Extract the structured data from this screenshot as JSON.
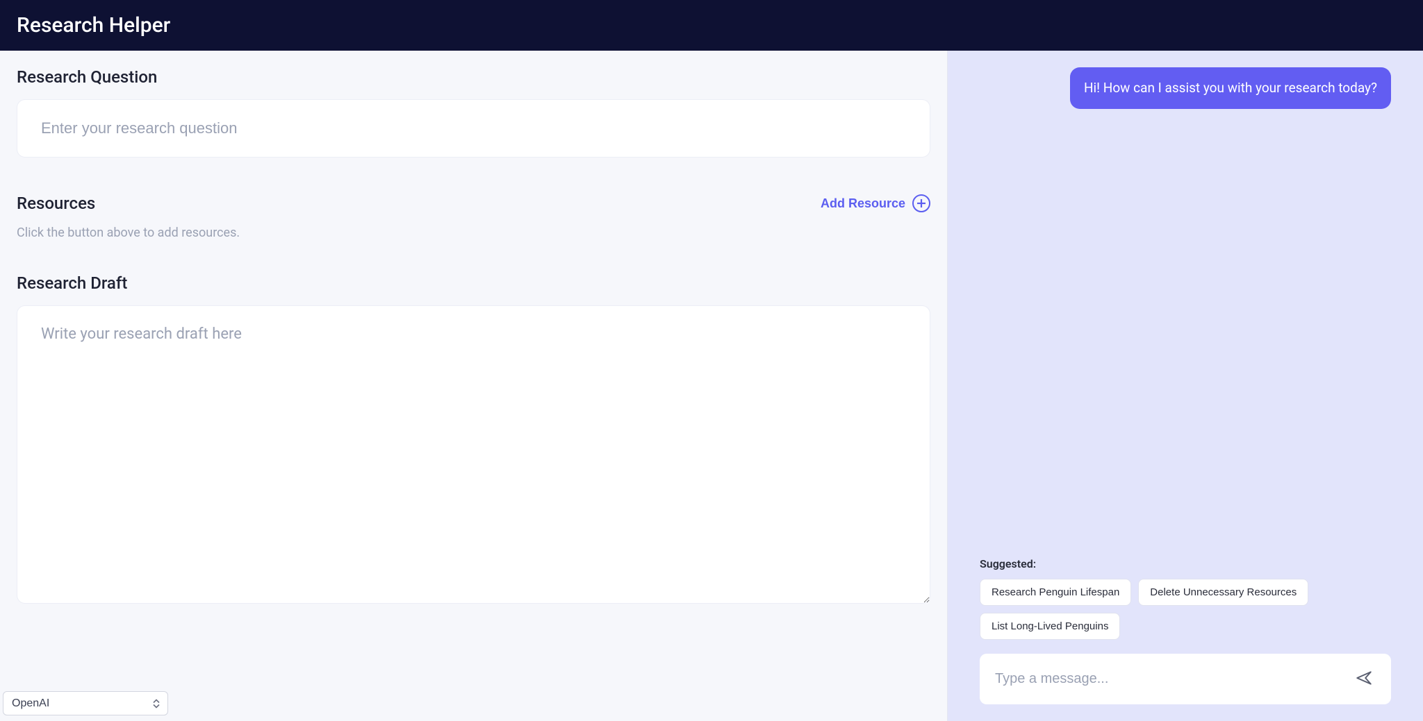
{
  "header": {
    "title": "Research Helper"
  },
  "sections": {
    "question": {
      "title": "Research Question",
      "placeholder": "Enter your research question",
      "value": ""
    },
    "resources": {
      "title": "Resources",
      "add_label": "Add Resource",
      "empty_text": "Click the button above to add resources."
    },
    "draft": {
      "title": "Research Draft",
      "placeholder": "Write your research draft here",
      "value": ""
    }
  },
  "model_selector": {
    "selected": "OpenAI"
  },
  "chat": {
    "messages": [
      {
        "role": "assistant",
        "text": "Hi! How can I assist you with your research today?"
      }
    ],
    "suggested_label": "Suggested:",
    "suggestions": [
      "Research Penguin Lifespan",
      "Delete Unnecessary Resources",
      "List Long-Lived Penguins"
    ],
    "input_placeholder": "Type a message...",
    "input_value": ""
  }
}
